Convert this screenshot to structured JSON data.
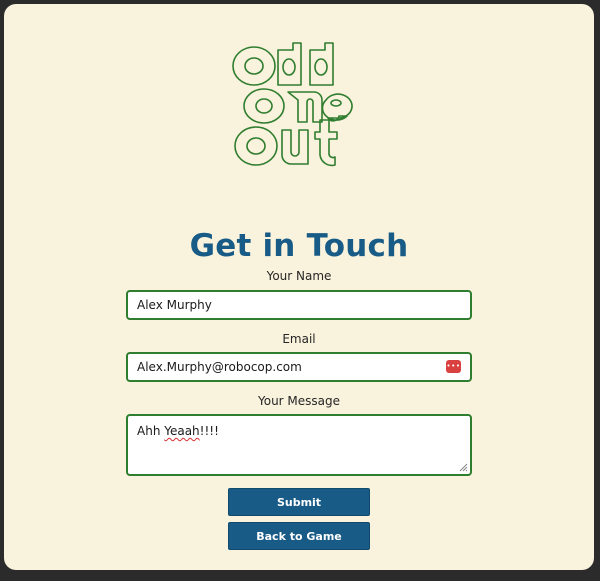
{
  "logo": {
    "text": "Odd One Out",
    "color": "#2f7d2f"
  },
  "heading": "Get in Touch",
  "form": {
    "name_label": "Your Name",
    "name_value": "Alex Murphy",
    "email_label": "Email",
    "email_value": "Alex.Murphy@robocop.com",
    "message_label": "Your Message",
    "message_value_word1": "Ahh ",
    "message_value_misspelled": "Yeaah",
    "message_value_end": "!!!!",
    "password_manager_icon": "password-manager-icon"
  },
  "buttons": {
    "submit_label": "Submit",
    "back_label": "Back to Game"
  },
  "colors": {
    "background": "#f9f2dc",
    "accent": "#185b86",
    "field_border": "#2f7d2f"
  }
}
